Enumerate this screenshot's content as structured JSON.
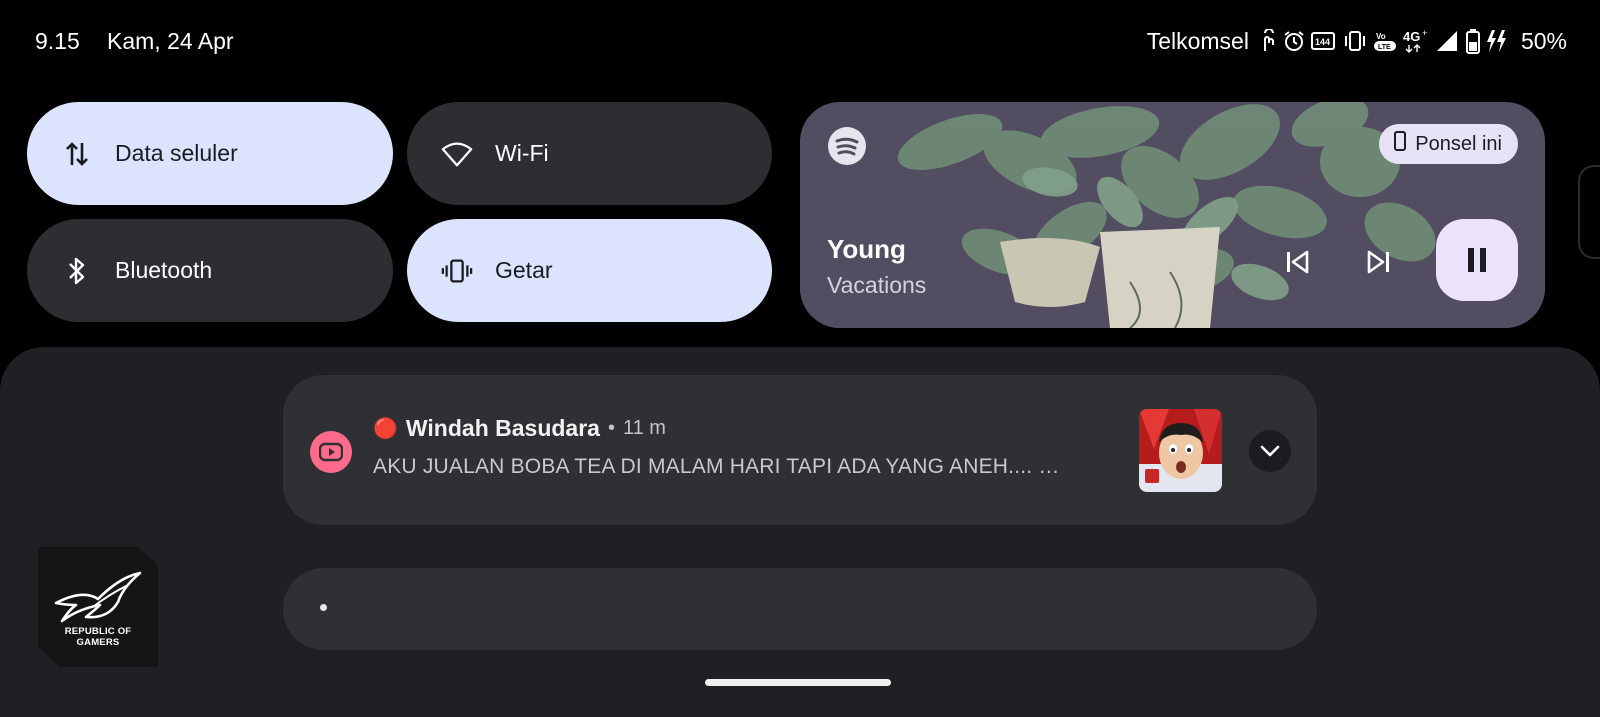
{
  "status_bar": {
    "time": "9.15",
    "date": "Kam, 24 Apr",
    "carrier": "Telkomsel",
    "network": "4G",
    "battery_percent": "50%",
    "icons": [
      "hand-gesture-icon",
      "alarm-icon",
      "refresh-rate-icon",
      "vibrate-icon",
      "volte-icon",
      "network-4g-icon",
      "signal-icon",
      "battery-icon",
      "charging-icon"
    ]
  },
  "quick_tiles": [
    {
      "label": "Data seluler",
      "state": "on",
      "icon": "mobile-data-icon"
    },
    {
      "label": "Wi-Fi",
      "state": "off",
      "icon": "wifi-icon"
    },
    {
      "label": "Bluetooth",
      "state": "off",
      "icon": "bluetooth-icon"
    },
    {
      "label": "Getar",
      "state": "on",
      "icon": "vibrate-icon"
    }
  ],
  "media": {
    "app_icon": "spotify-icon",
    "output_device": "Ponsel ini",
    "title": "Young",
    "artist": "Vacations",
    "controls": [
      "previous-icon",
      "next-icon",
      "pause-icon"
    ]
  },
  "notification": {
    "app_icon": "youtube-icon",
    "emoji": "🔴",
    "title": "Windah Basudara",
    "separator": "•",
    "time": "11 m",
    "text": "AKU JUALAN BOBA TEA DI MALAM HARI TAPI ADA YANG ANEH.... …"
  },
  "empty_card": {
    "dot": "•"
  },
  "logo": {
    "line1": "REPUBLIC OF",
    "line2": "GAMERS"
  },
  "colors": {
    "tile_on": "#dbe3fd",
    "tile_off": "#2d2e32",
    "shade": "#1f2023",
    "card": "#2e3034",
    "youtube_icon": "#ff6b8b",
    "media_bg": "#504c5f"
  }
}
